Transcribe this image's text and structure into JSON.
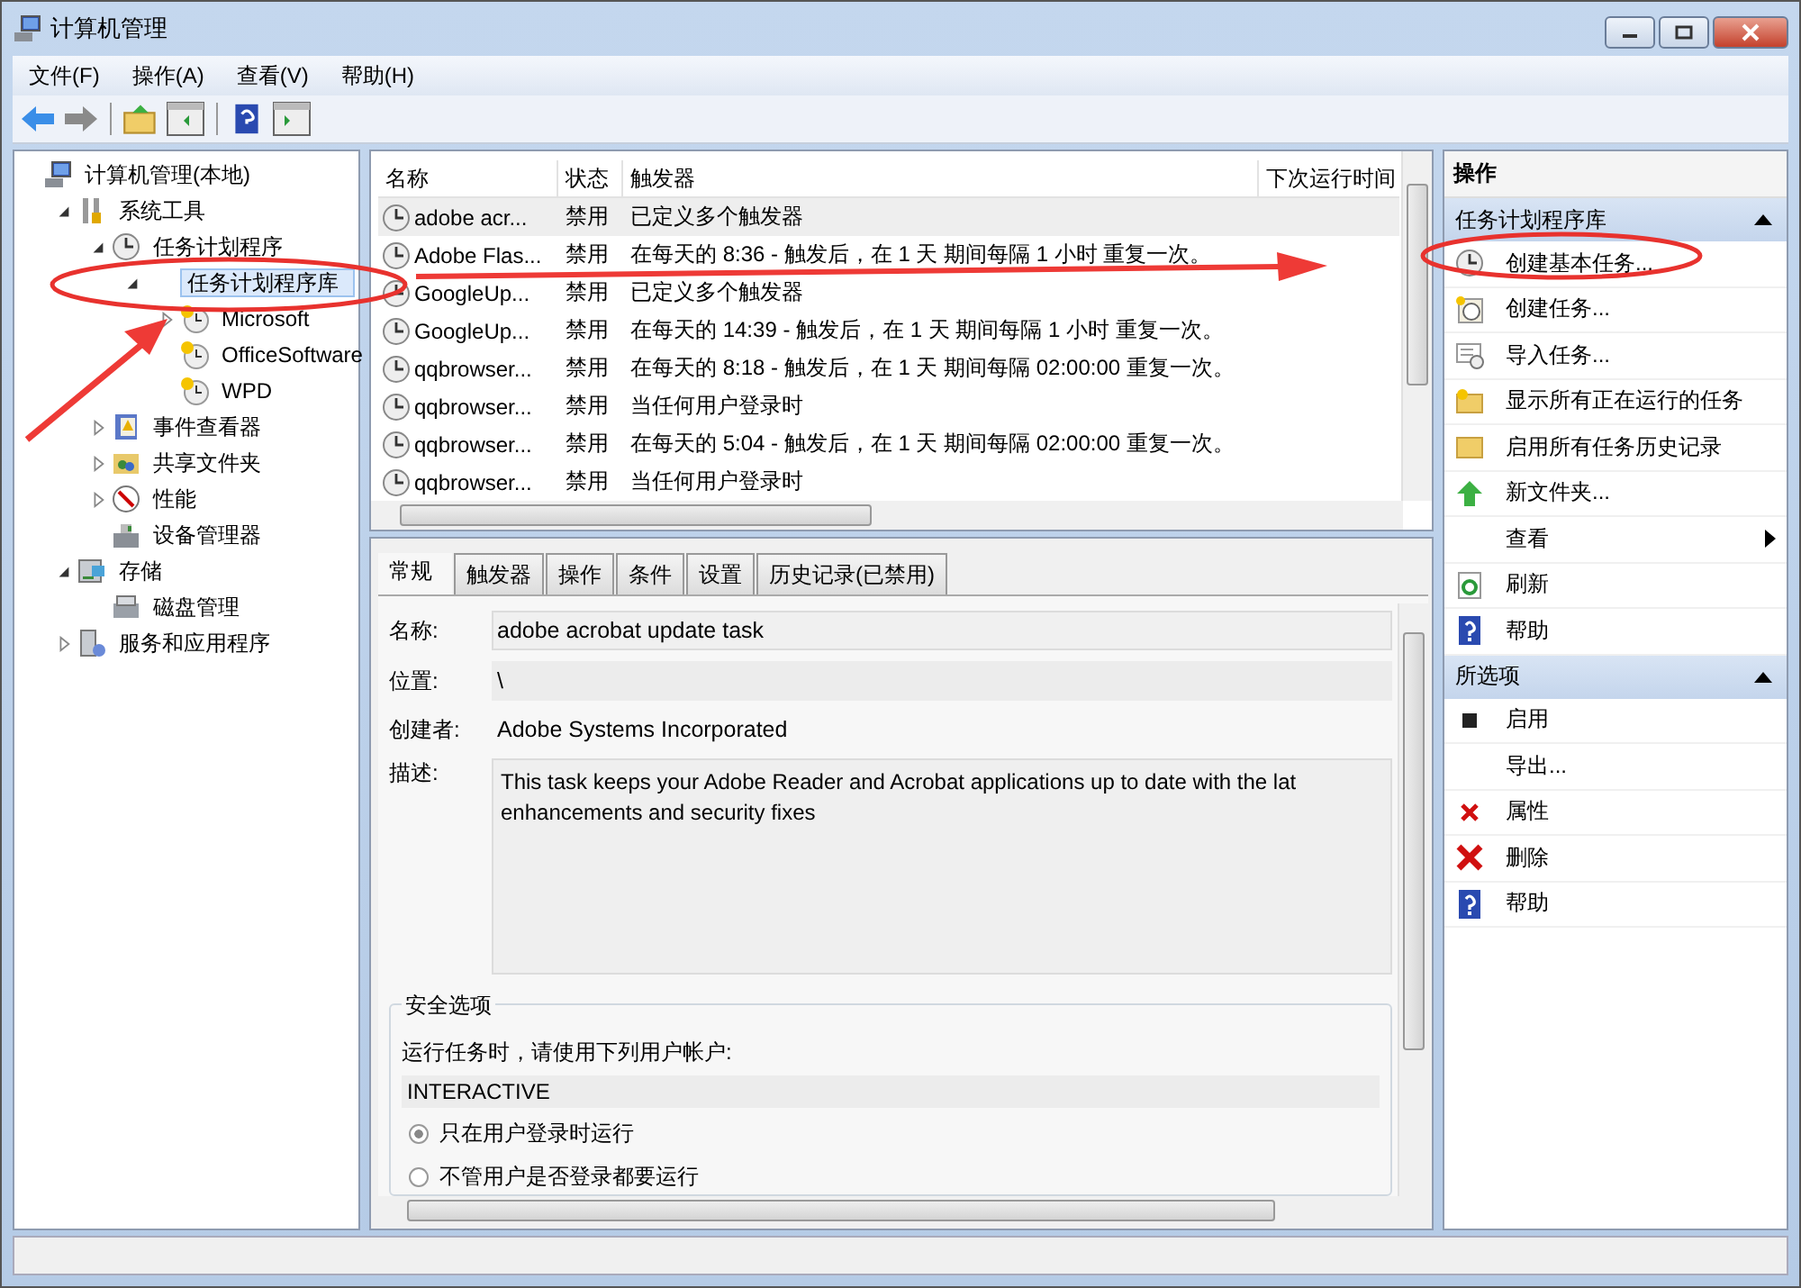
{
  "window": {
    "title": "计算机管理"
  },
  "menu": [
    {
      "label": "文件(F)"
    },
    {
      "label": "操作(A)"
    },
    {
      "label": "查看(V)"
    },
    {
      "label": "帮助(H)"
    }
  ],
  "tree": [
    {
      "label": "计算机管理(本地)",
      "selected": false,
      "children": [
        {
          "label": "系统工具",
          "expanded": true,
          "selected": false,
          "children": [
            {
              "label": "任务计划程序",
              "expanded": true,
              "selected": false,
              "children": [
                {
                  "label": "任务计划程序库",
                  "expanded": true,
                  "selected": true,
                  "children": [
                    {
                      "label": "Microsoft",
                      "expanded": false,
                      "selected": false
                    },
                    {
                      "label": "OfficeSoftware",
                      "selected": false
                    },
                    {
                      "label": "WPD",
                      "selected": false
                    }
                  ]
                }
              ]
            },
            {
              "label": "事件查看器",
              "expanded": false,
              "selected": false
            },
            {
              "label": "共享文件夹",
              "expanded": false,
              "selected": false
            },
            {
              "label": "性能",
              "expanded": false,
              "selected": false
            },
            {
              "label": "设备管理器",
              "selected": false
            }
          ]
        },
        {
          "label": "存储",
          "expanded": true,
          "selected": false,
          "children": [
            {
              "label": "磁盘管理",
              "selected": false
            }
          ]
        },
        {
          "label": "服务和应用程序",
          "expanded": false,
          "selected": false
        }
      ]
    }
  ],
  "table": {
    "columns": [
      "名称",
      "状态",
      "触发器",
      "下次运行时间"
    ],
    "rows": [
      {
        "name": "adobe acr...",
        "status": "禁用",
        "trigger": "已定义多个触发器",
        "selected": true
      },
      {
        "name": "Adobe Flas...",
        "status": "禁用",
        "trigger": "在每天的 8:36 - 触发后，在 1 天 期间每隔 1 小时 重复一次。",
        "selected": false
      },
      {
        "name": "GoogleUp...",
        "status": "禁用",
        "trigger": "已定义多个触发器",
        "selected": false
      },
      {
        "name": "GoogleUp...",
        "status": "禁用",
        "trigger": "在每天的 14:39 - 触发后，在 1 天 期间每隔 1 小时 重复一次。",
        "selected": false
      },
      {
        "name": "qqbrowser...",
        "status": "禁用",
        "trigger": "在每天的 8:18 - 触发后，在 1 天 期间每隔 02:00:00 重复一次。",
        "selected": false
      },
      {
        "name": "qqbrowser...",
        "status": "禁用",
        "trigger": "当任何用户登录时",
        "selected": false
      },
      {
        "name": "qqbrowser...",
        "status": "禁用",
        "trigger": "在每天的 5:04 - 触发后，在 1 天 期间每隔 02:00:00 重复一次。",
        "selected": false
      },
      {
        "name": "qqbrowser...",
        "status": "禁用",
        "trigger": "当任何用户登录时",
        "selected": false
      }
    ]
  },
  "detail": {
    "tabs": [
      {
        "label": "常规",
        "selected": true
      },
      {
        "label": "触发器",
        "selected": false
      },
      {
        "label": "操作",
        "selected": false
      },
      {
        "label": "条件",
        "selected": false
      },
      {
        "label": "设置",
        "selected": false
      },
      {
        "label": "历史记录(已禁用)",
        "selected": false
      }
    ],
    "name_label": "名称:",
    "name": "adobe acrobat update task",
    "location_label": "位置:",
    "location": "\\",
    "author_label": "创建者:",
    "author": "Adobe Systems Incorporated",
    "description_label": "描述:",
    "description_lines": [
      "This task keeps your Adobe Reader and Acrobat applications up to date with the lat",
      "enhancements and security fixes"
    ],
    "security": {
      "title": "安全选项",
      "prompt": "运行任务时，请使用下列用户帐户:",
      "account": "INTERACTIVE",
      "options": [
        {
          "label": "只在用户登录时运行",
          "selected": true
        },
        {
          "label": "不管用户是否登录都要运行",
          "selected": false
        }
      ]
    }
  },
  "actions": {
    "title": "操作",
    "sections": [
      {
        "title": "任务计划程序库",
        "expanded": true,
        "items": [
          {
            "label": "创建基本任务...",
            "submenu": false
          },
          {
            "label": "创建任务...",
            "submenu": false
          },
          {
            "label": "导入任务...",
            "submenu": false
          },
          {
            "label": "显示所有正在运行的任务",
            "submenu": false
          },
          {
            "label": "启用所有任务历史记录",
            "submenu": false
          },
          {
            "label": "新文件夹...",
            "submenu": false
          },
          {
            "label": "查看",
            "submenu": true
          },
          {
            "label": "刷新",
            "submenu": false
          },
          {
            "label": "帮助",
            "submenu": false
          }
        ]
      },
      {
        "title": "所选项",
        "expanded": true,
        "items": [
          {
            "label": "启用",
            "submenu": false
          },
          {
            "label": "导出...",
            "submenu": false
          },
          {
            "label": "属性",
            "submenu": false
          },
          {
            "label": "删除",
            "submenu": false
          },
          {
            "label": "帮助",
            "submenu": false
          }
        ]
      }
    ]
  }
}
